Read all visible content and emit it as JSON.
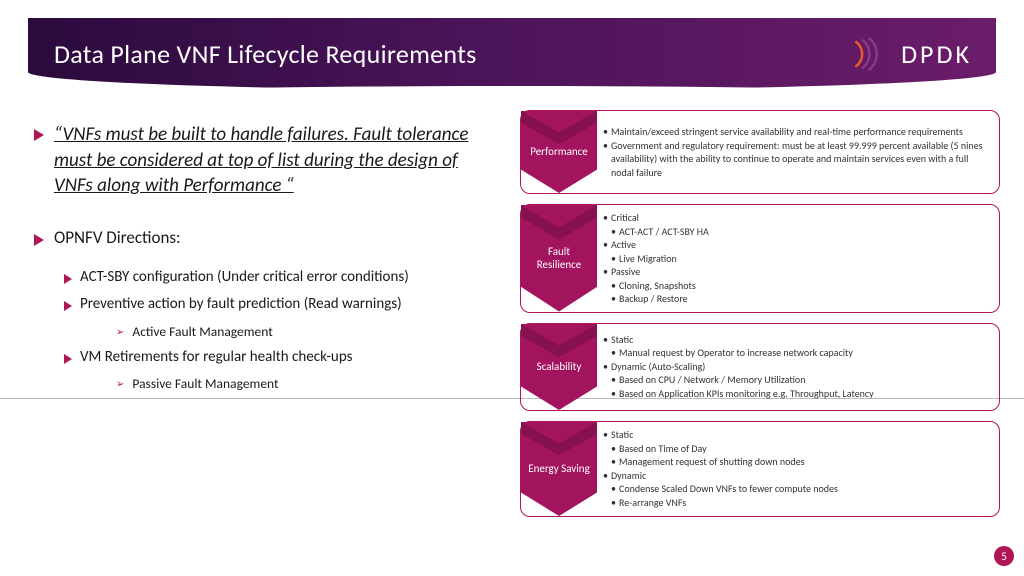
{
  "title": "Data Plane VNF Lifecycle Requirements",
  "logo_text": "DPDK",
  "quote": "“VNFs must be built to handle failures. Fault tolerance must be considered at top of list during the design of VNFs along with Performance “",
  "directions_heading": "OPNFV Directions:",
  "dir": {
    "a": "ACT-SBY configuration (Under critical error conditions)",
    "b": "Preventive action by fault prediction (Read warnings)",
    "b_sub": "Active Fault Management",
    "c": "VM Retirements for regular health check-ups",
    "c_sub": "Passive Fault Management"
  },
  "cards": {
    "perf": {
      "label": "Performance",
      "l1": "Maintain/exceed stringent service availability and real-time performance requirements",
      "l2": "Government and regulatory requirement: must be at least 99.999 percent available (5 nines availability) with the ability to continue to operate and maintain services even with a full nodal failure"
    },
    "fault": {
      "label": "Fault Resilience",
      "l1": "Critical",
      "l1a": "ACT-ACT / ACT-SBY HA",
      "l2": "Active",
      "l2a": "Live Migration",
      "l3": "Passive",
      "l3a": "Cloning, Snapshots",
      "l3b": "Backup / Restore"
    },
    "scal": {
      "label": "Scalability",
      "l1": "Static",
      "l1a": "Manual request by Operator to increase network capacity",
      "l2": "Dynamic (Auto-Scaling)",
      "l2a": "Based on CPU / Network  / Memory Utilization",
      "l2b": "Based on Application KPIs monitoring e.g. Throughput, Latency"
    },
    "energy": {
      "label": "Energy Saving",
      "l1": "Static",
      "l1a": "Based on Time of Day",
      "l1b": "Management request of shutting down nodes",
      "l2": "Dynamic",
      "l2a": "Condense Scaled Down VNFs to fewer compute nodes",
      "l2b": "Re-arrange VNFs"
    }
  },
  "page_number": "5"
}
